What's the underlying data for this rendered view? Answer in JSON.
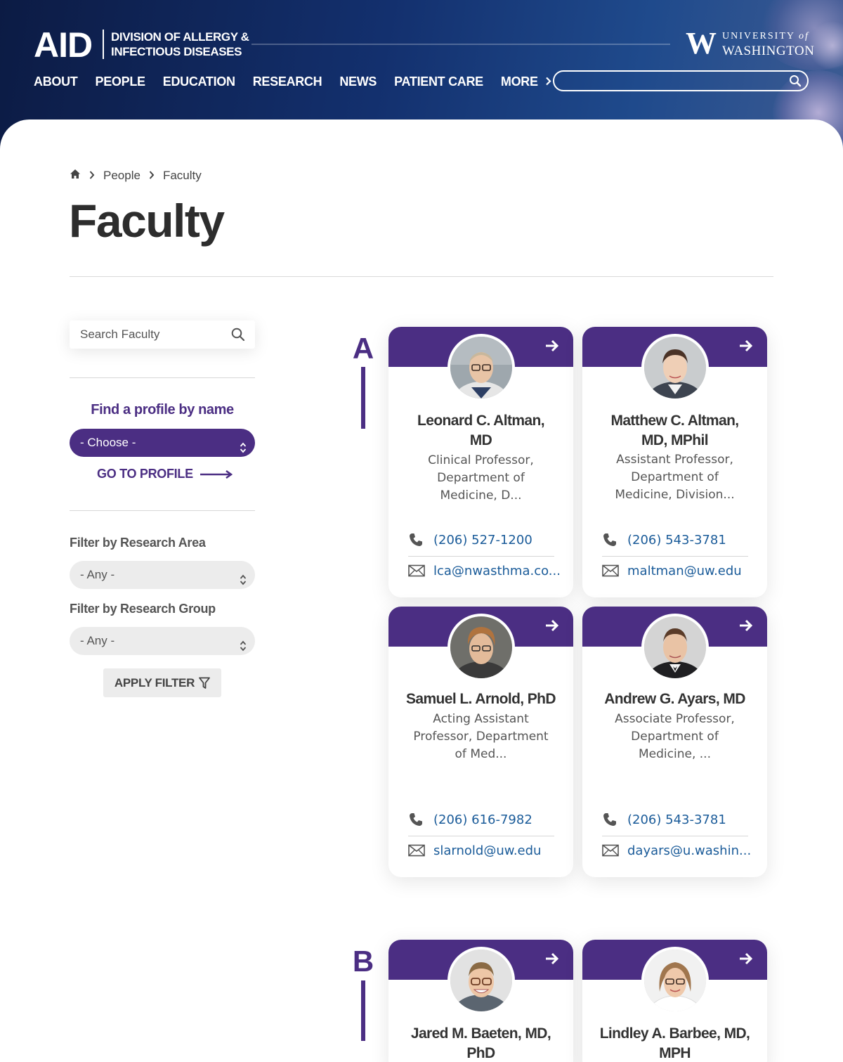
{
  "header": {
    "logo": "AID",
    "subtitle_line1": "DIVISION OF ALLERGY &",
    "subtitle_line2": "INFECTIOUS DISEASES",
    "uw_line1": "UNIVERSITY",
    "uw_of": "of",
    "uw_line2": "WASHINGTON",
    "nav": [
      "ABOUT",
      "PEOPLE",
      "EDUCATION",
      "RESEARCH",
      "NEWS",
      "PATIENT CARE",
      "MORE"
    ],
    "search_placeholder": ""
  },
  "breadcrumb": [
    "People",
    "Faculty"
  ],
  "page_title": "Faculty",
  "sidebar": {
    "search_placeholder": "Search Faculty",
    "find_title": "Find a profile by name",
    "choose_label": "- Choose -",
    "goto_label": "GO TO PROFILE",
    "research_area_label": "Filter by Research Area",
    "research_area_value": "- Any -",
    "research_group_label": "Filter by Research Group",
    "research_group_value": "- Any -",
    "apply_label": "APPLY FILTER"
  },
  "sections": [
    {
      "letter": "A",
      "cards": [
        {
          "name_l1": "Leonard C. Altman,",
          "name_l2": "MD",
          "title_l1": "Clinical Professor,",
          "title_l2": "Department of",
          "title_l3": "Medicine, D...",
          "phone": "(206) 527-1200",
          "email": "lca@nwasthma.co..."
        },
        {
          "name_l1": "Matthew C. Altman,",
          "name_l2": "MD, MPhil",
          "title_l1": "Assistant Professor,",
          "title_l2": "Department of",
          "title_l3": "Medicine, Division...",
          "phone": "(206) 543-3781",
          "email": "maltman@uw.edu"
        },
        {
          "name_l1": "Samuel L. Arnold, PhD",
          "name_l2": "",
          "title_l1": "Acting Assistant",
          "title_l2": "Professor, Department",
          "title_l3": "of Med...",
          "phone": "(206) 616-7982",
          "email": "slarnold@uw.edu"
        },
        {
          "name_l1": "Andrew G. Ayars, MD",
          "name_l2": "",
          "title_l1": "Associate Professor,",
          "title_l2": "Department of",
          "title_l3": "Medicine, ...",
          "phone": "(206) 543-3781",
          "email": "dayars@u.washin..."
        }
      ]
    },
    {
      "letter": "B",
      "cards": [
        {
          "name_l1": "Jared M. Baeten, MD,",
          "name_l2": "PhD"
        },
        {
          "name_l1": "Lindley A. Barbee, MD,",
          "name_l2": "MPH"
        }
      ]
    }
  ],
  "colors": {
    "accent": "#4b2e83",
    "link": "#1a5b99",
    "header_dark": "#0c1b44"
  }
}
